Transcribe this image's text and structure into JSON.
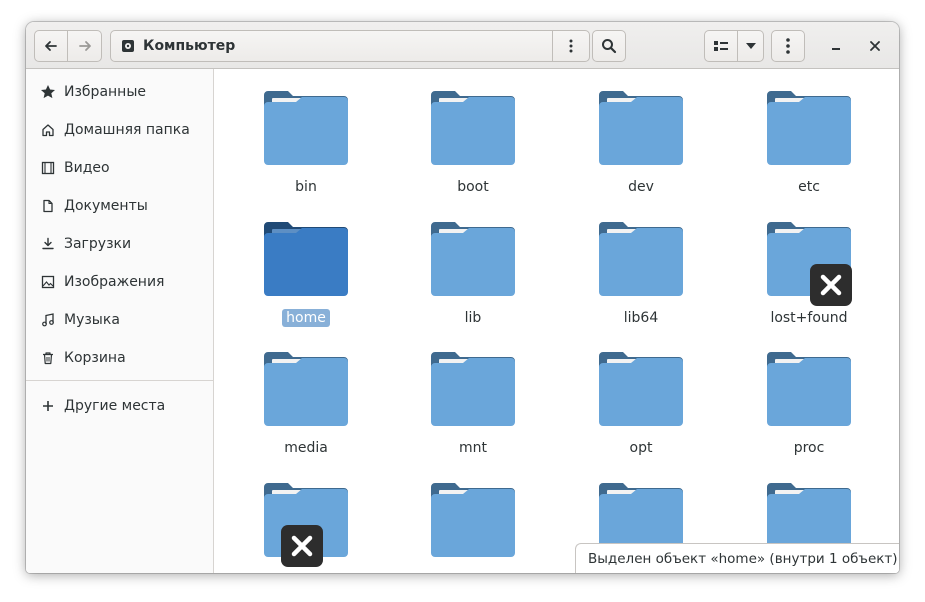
{
  "headerbar": {
    "location": "Компьютер"
  },
  "sidebar": {
    "items": [
      {
        "label": "Избранные",
        "icon": "star-icon"
      },
      {
        "label": "Домашняя папка",
        "icon": "home-icon"
      },
      {
        "label": "Видео",
        "icon": "video-icon"
      },
      {
        "label": "Документы",
        "icon": "document-icon"
      },
      {
        "label": "Загрузки",
        "icon": "download-icon"
      },
      {
        "label": "Изображения",
        "icon": "image-icon"
      },
      {
        "label": "Музыка",
        "icon": "music-icon"
      },
      {
        "label": "Корзина",
        "icon": "trash-icon"
      }
    ],
    "other_locations": "Другие места"
  },
  "files": [
    {
      "name": "bin"
    },
    {
      "name": "boot"
    },
    {
      "name": "dev"
    },
    {
      "name": "etc"
    },
    {
      "name": "home",
      "selected": true
    },
    {
      "name": "lib"
    },
    {
      "name": "lib64"
    },
    {
      "name": "lost+found",
      "emblem": "unreadable-x-icon"
    },
    {
      "name": "media"
    },
    {
      "name": "mnt"
    },
    {
      "name": "opt"
    },
    {
      "name": "proc"
    },
    {
      "name": "",
      "emblem": "unreadable-x-icon"
    },
    {
      "name": ""
    },
    {
      "name": ""
    },
    {
      "name": ""
    }
  ],
  "status": {
    "text": "Выделен объект «home» (внутри 1 объект)"
  },
  "colors": {
    "folder_body": "#6aa6da",
    "folder_tab": "#3f6a8f",
    "selected_folder": "#3a7cc4",
    "selection_label": "#88b0d8"
  }
}
